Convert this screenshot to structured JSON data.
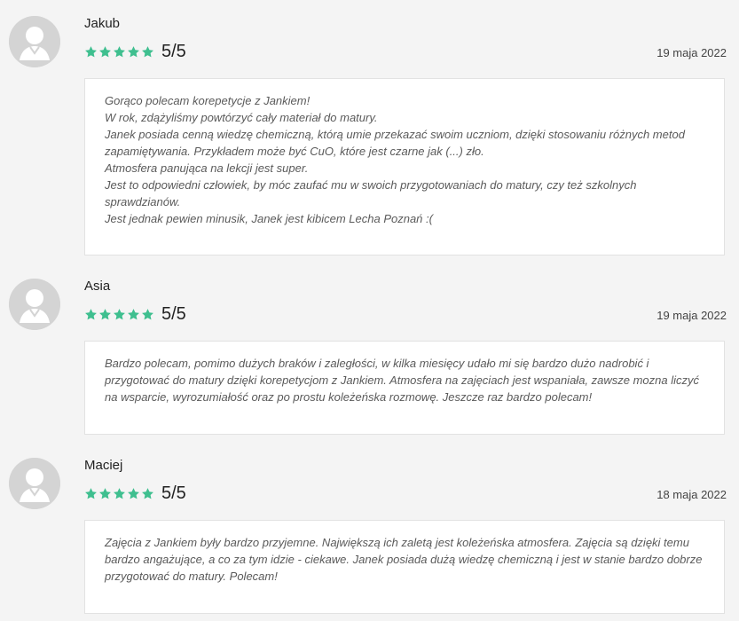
{
  "colors": {
    "star": "#3fbf8f",
    "avatar_bg": "#d4d4d4"
  },
  "reviews": [
    {
      "name": "Jakub",
      "stars": 5,
      "score": "5/5",
      "date": "19 maja 2022",
      "lines": [
        "Gorąco polecam korepetycje z Jankiem!",
        "W rok, zdążyliśmy powtórzyć cały materiał do matury.",
        "Janek posiada cenną wiedzę chemiczną, którą umie przekazać swoim uczniom, dzięki stosowaniu różnych metod",
        "zapamiętywania. Przykładem może być CuO, które jest czarne jak (...) zło.",
        "Atmosfera panująca na lekcji jest super.",
        "Jest to odpowiedni człowiek, by móc zaufać mu w swoich przygotowaniach do matury, czy też szkolnych",
        "sprawdzianów.",
        "Jest jednak pewien minusik, Janek jest kibicem Lecha Poznań :("
      ]
    },
    {
      "name": "Asia",
      "stars": 5,
      "score": "5/5",
      "date": "19 maja 2022",
      "lines": [
        "Bardzo polecam, pomimo dużych braków i zaległości, w kilka miesięcy udało mi się bardzo dużo nadrobić i",
        "przygotować do matury dzięki korepetycjom z Jankiem. Atmosfera na zajęciach jest wspaniała, zawsze mozna liczyć",
        "na wsparcie, wyrozumiałość oraz po prostu koleżeńska rozmowę. Jeszcze raz bardzo polecam!"
      ]
    },
    {
      "name": "Maciej",
      "stars": 5,
      "score": "5/5",
      "date": "18 maja 2022",
      "lines": [
        "Zajęcia z Jankiem były bardzo przyjemne. Największą ich zaletą jest koleżeńska atmosfera. Zajęcia są dzięki temu",
        "bardzo angażujące, a co za tym idzie - ciekawe. Janek posiada dużą wiedzę chemiczną i jest w stanie bardzo dobrze",
        "przygotować do matury. Polecam!"
      ]
    }
  ]
}
